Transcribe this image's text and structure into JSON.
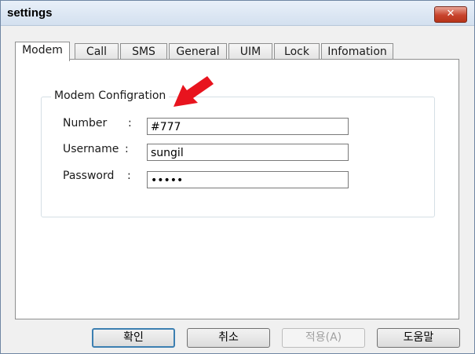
{
  "window": {
    "title": "settings",
    "close_glyph": "✕"
  },
  "tabs": [
    {
      "label": "Modem",
      "active": true
    },
    {
      "label": "Call"
    },
    {
      "label": "SMS"
    },
    {
      "label": "General"
    },
    {
      "label": "UIM"
    },
    {
      "label": "Lock"
    },
    {
      "label": "Infomation"
    }
  ],
  "group": {
    "title": "Modem Configration",
    "fields": {
      "number": {
        "label": "Number",
        "colon": ":",
        "value": "#777"
      },
      "username": {
        "label": "Username",
        "colon": ":",
        "value": "sungil"
      },
      "password": {
        "label": "Password",
        "colon": ":",
        "value": "•••••"
      }
    }
  },
  "annotation": {
    "arrow_color": "#e8141e"
  },
  "buttons": {
    "ok": "확인",
    "cancel": "취소",
    "apply": "적용(A)",
    "help": "도움말"
  }
}
